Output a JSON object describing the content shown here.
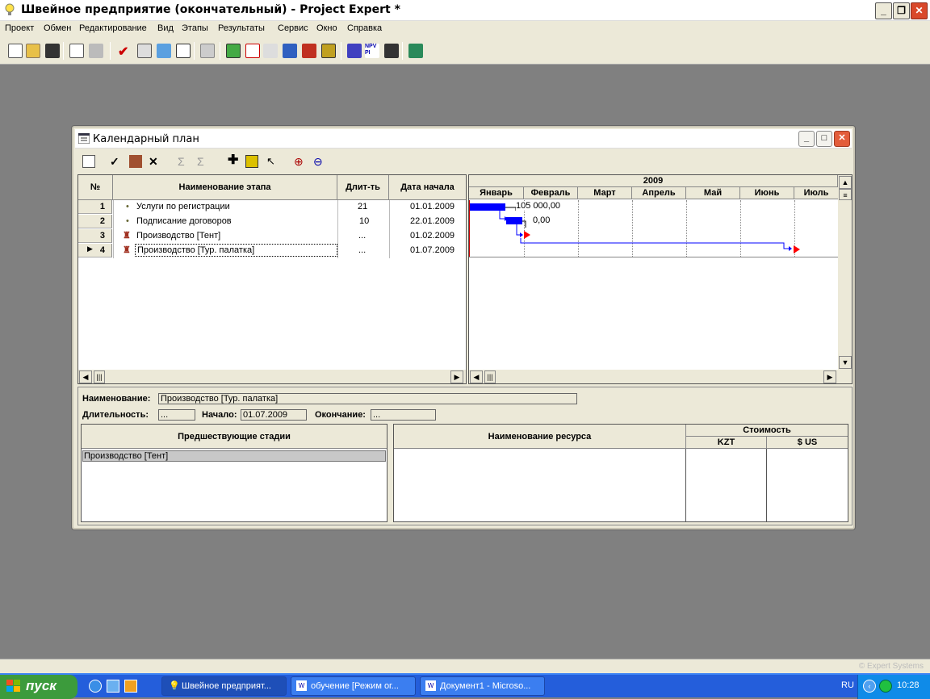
{
  "app": {
    "title": "Швейное предприятие (окончательный) - Project Expert *",
    "copyright": "© Expert Systems"
  },
  "menu": [
    "Проект",
    "Обмен",
    "Редактирование",
    "Вид",
    "Этапы",
    "Результаты",
    "Сервис",
    "Окно",
    "Справка"
  ],
  "calendar": {
    "title": "Календарный план",
    "headers": {
      "num": "№",
      "name": "Наименование этапа",
      "dur": "Длит-ть",
      "start": "Дата начала"
    },
    "rows": [
      {
        "num": "1",
        "name": "Услуги по регистрации",
        "dur": "21",
        "start": "01.01.2009"
      },
      {
        "num": "2",
        "name": "Подписание договоров",
        "dur": "10",
        "start": "22.01.2009"
      },
      {
        "num": "3",
        "name": "Производство [Тент]",
        "dur": "...",
        "start": "01.02.2009"
      },
      {
        "num": "4",
        "name": "Производство [Тур. палатка]",
        "dur": "...",
        "start": "01.07.2009"
      }
    ],
    "gantt": {
      "year": "2009",
      "months": [
        "Январь",
        "Февраль",
        "Март",
        "Апрель",
        "Май",
        "Июнь",
        "Июль"
      ],
      "label1": "105 000,00",
      "label2": "0,00"
    }
  },
  "details": {
    "name_label": "Наименование:",
    "name_value": "Производство [Тур. палатка]",
    "dur_label": "Длительность:",
    "dur_value": "...",
    "start_label": "Начало:",
    "start_value": "01.07.2009",
    "end_label": "Окончание:",
    "end_value": "...",
    "pred_header": "Предшествующие стадии",
    "pred_item": "Производство [Тент]",
    "res_header": "Наименование ресурса",
    "cost_header": "Стоимость",
    "cur1": "KZT",
    "cur2": "$ US"
  },
  "taskbar": {
    "start": "пуск",
    "tasks": [
      "Швейное предприят...",
      "обучение [Режим ог...",
      "Документ1 - Microso..."
    ],
    "lang": "RU",
    "time": "10:28"
  },
  "colors": {
    "bar": "#0000ff",
    "milestone": "#ff0000",
    "selection": "#c8c8c8"
  }
}
